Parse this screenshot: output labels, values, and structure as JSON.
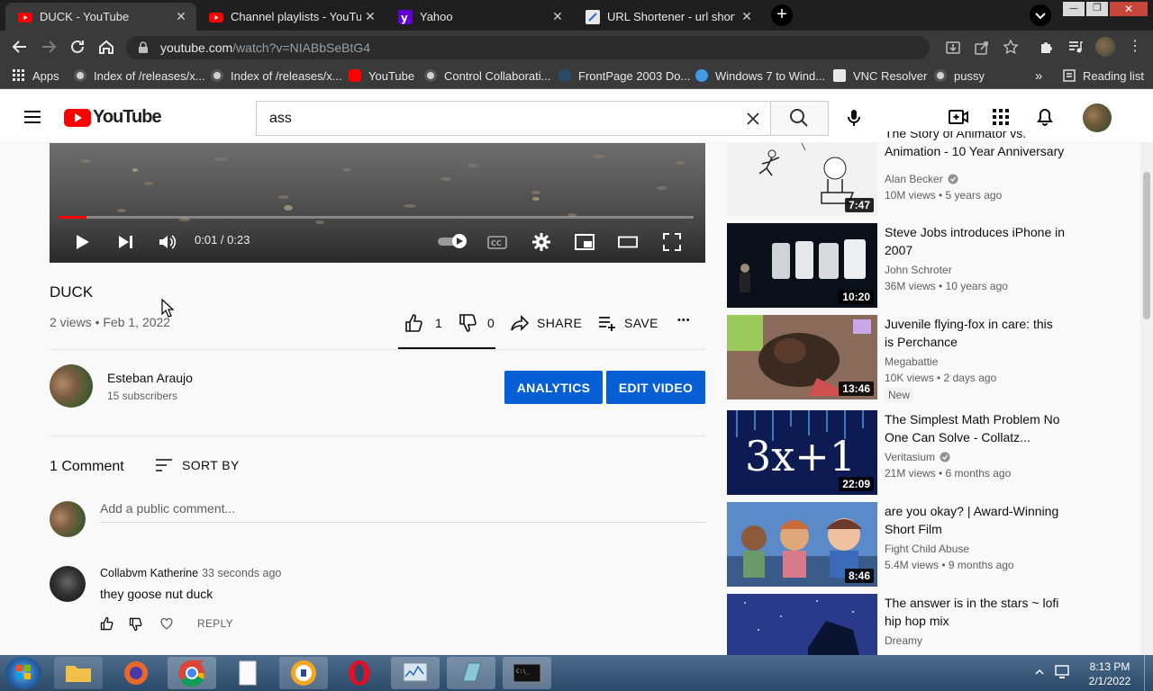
{
  "browser": {
    "tabs": [
      {
        "title": "DUCK - YouTube",
        "active": true
      },
      {
        "title": "Channel playlists - YouTube",
        "active": false
      },
      {
        "title": "Yahoo",
        "active": false
      },
      {
        "title": "URL Shortener - url shorten",
        "active": false
      }
    ],
    "url_host": "youtube.com",
    "url_path": "/watch?v=NIABbSeBtG4",
    "bookmarks": [
      "Apps",
      "Index of /releases/x...",
      "Index of /releases/x...",
      "YouTube",
      "Control Collaborati...",
      "FrontPage 2003 Do...",
      "Windows 7 to Wind...",
      "VNC Resolver",
      "pussy"
    ],
    "overflow_label": "»",
    "reading_list": "Reading list"
  },
  "header": {
    "logo_text": "YouTube",
    "search_value": "ass"
  },
  "player": {
    "time": "0:01 / 0:23",
    "progress_fraction": 0.0435
  },
  "video": {
    "title": "DUCK",
    "meta": "2 views • Feb 1, 2022",
    "likes": "1",
    "dislikes": "0",
    "share_label": "SHARE",
    "save_label": "SAVE",
    "more_label": "•••"
  },
  "channel": {
    "name": "Esteban Araujo",
    "subscribers": "15 subscribers",
    "analytics_label": "ANALYTICS",
    "edit_label": "EDIT VIDEO"
  },
  "comments": {
    "count_label": "1 Comment",
    "sort_label": "SORT BY",
    "placeholder": "Add a public comment...",
    "items": [
      {
        "author": "Collabvm Katherine",
        "time": "33 seconds ago",
        "text": "they goose nut duck",
        "reply_label": "REPLY"
      }
    ]
  },
  "recommendations": [
    {
      "title": "The Story of Animator vs. Animation - 10 Year Anniversary",
      "title_visible_line1": "The Story of Animator vs.",
      "title_visible_line2": "Animation - 10 Year Anniversary",
      "channel": "Alan Becker",
      "verified": true,
      "meta": "10M views • 5 years ago",
      "duration": "7:47"
    },
    {
      "title": "Steve Jobs introduces iPhone in 2007",
      "title_line1": "Steve Jobs introduces iPhone in",
      "title_line2": "2007",
      "channel": "John Schroter",
      "verified": false,
      "meta": "36M views • 10 years ago",
      "duration": "10:20"
    },
    {
      "title_line1": "Juvenile flying-fox in care: this",
      "title_line2": "is Perchance",
      "channel": "Megabattie",
      "verified": false,
      "meta": "10K views • 2 days ago",
      "badge": "New",
      "duration": "13:46"
    },
    {
      "title_line1": "The Simplest Math Problem No",
      "title_line2": "One Can Solve - Collatz...",
      "channel": "Veritasium",
      "verified": true,
      "meta": "21M views • 6 months ago",
      "duration": "22:09",
      "thumb_text": "3x+1"
    },
    {
      "title_line1": "are you okay? | Award-Winning",
      "title_line2": "Short Film",
      "channel": "Fight Child Abuse",
      "verified": false,
      "meta": "5.4M views • 9 months ago",
      "duration": "8:46"
    },
    {
      "title_line1": "The answer is in the stars ~ lofi",
      "title_line2": "hip hop mix",
      "channel": "Dreamy",
      "verified": false,
      "meta": "",
      "duration": ""
    }
  ],
  "taskbar": {
    "time": "8:13 PM",
    "date": "2/1/2022"
  },
  "colors": {
    "brand_red": "#ff0000",
    "accent_blue": "#065fd4",
    "chrome_dark": "#3a3a3a"
  }
}
